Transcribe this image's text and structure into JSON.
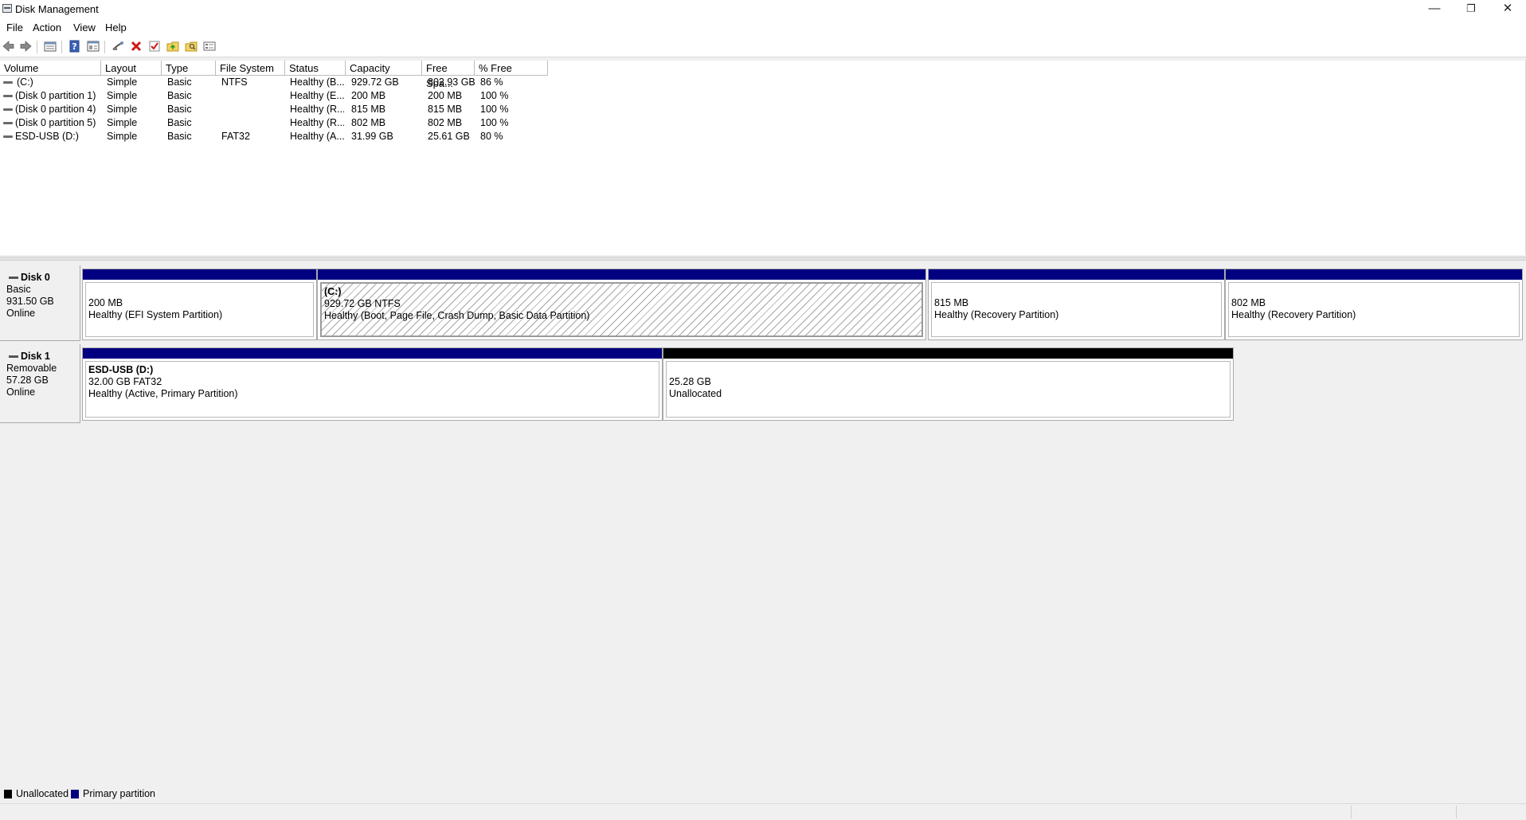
{
  "window": {
    "title": "Disk Management",
    "minimize": "—",
    "maximize": "❐",
    "close": "✕"
  },
  "menu": [
    "File",
    "Action",
    "View",
    "Help"
  ],
  "toolbar": {
    "icons": [
      "back-icon",
      "forward-icon",
      "disk-list-icon",
      "help-icon",
      "properties-icon",
      "connect-icon",
      "delete-icon",
      "check-icon",
      "new-folder-icon",
      "open-folder-icon",
      "view-icon"
    ]
  },
  "volume_list": {
    "columns": [
      "Volume",
      "Layout",
      "Type",
      "File System",
      "Status",
      "Capacity",
      "Free Spa...",
      "% Free"
    ],
    "rows": [
      [
        "(C:)",
        "Simple",
        "Basic",
        "NTFS",
        "Healthy (B...",
        "929.72 GB",
        "802.93 GB",
        "86 %"
      ],
      [
        "(Disk 0 partition 1)",
        "Simple",
        "Basic",
        "",
        "Healthy (E...",
        "200 MB",
        "200 MB",
        "100 %"
      ],
      [
        "(Disk 0 partition 4)",
        "Simple",
        "Basic",
        "",
        "Healthy (R...",
        "815 MB",
        "815 MB",
        "100 %"
      ],
      [
        "(Disk 0 partition 5)",
        "Simple",
        "Basic",
        "",
        "Healthy (R...",
        "802 MB",
        "802 MB",
        "100 %"
      ],
      [
        "ESD-USB (D:)",
        "Simple",
        "Basic",
        "FAT32",
        "Healthy (A...",
        "31.99 GB",
        "25.61 GB",
        "80 %"
      ]
    ]
  },
  "disks": [
    {
      "name": "Disk 0",
      "kind": "Basic",
      "size": "931.50 GB",
      "state": "Online",
      "partitions": [
        {
          "label": "",
          "size": "200 MB",
          "status": "Healthy (EFI System Partition)"
        },
        {
          "label": "(C:)",
          "size": "929.72 GB NTFS",
          "status": "Healthy (Boot, Page File, Crash Dump, Basic Data Partition)"
        },
        {
          "label": "",
          "size": "815 MB",
          "status": "Healthy (Recovery Partition)"
        },
        {
          "label": "",
          "size": "802 MB",
          "status": "Healthy (Recovery Partition)"
        }
      ]
    },
    {
      "name": "Disk 1",
      "kind": "Removable",
      "size": "57.28 GB",
      "state": "Online",
      "partitions": [
        {
          "label": "ESD-USB  (D:)",
          "size": "32.00 GB FAT32",
          "status": "Healthy (Active, Primary Partition)"
        },
        {
          "label": "",
          "size": "25.28 GB",
          "status": "Unallocated"
        }
      ]
    }
  ],
  "legend": [
    {
      "label": "Unallocated",
      "color": "#000000"
    },
    {
      "label": "Primary partition",
      "color": "#000080"
    }
  ]
}
